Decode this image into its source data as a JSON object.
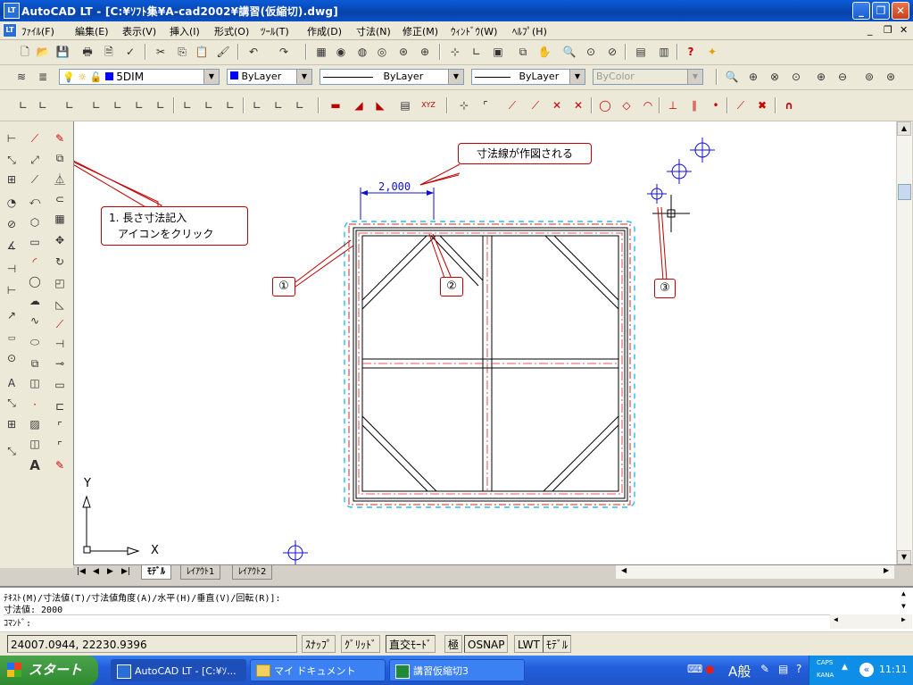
{
  "window": {
    "title": "AutoCAD LT - [C:¥ｿﾌﾄ集¥A-cad2002¥講習(仮縮切).dwg]",
    "app_icon": "LT",
    "controls": [
      "minimize",
      "restore",
      "close"
    ]
  },
  "menubar": {
    "items": [
      "ﾌｧｲﾙ(F)",
      "編集(E)",
      "表示(V)",
      "挿入(I)",
      "形式(O)",
      "ﾂｰﾙ(T)",
      "作成(D)",
      "寸法(N)",
      "修正(M)",
      "ｳｨﾝﾄﾞｳ(W)",
      "ﾍﾙﾌﾟ(H)"
    ]
  },
  "properties_toolbar": {
    "layer_value": "5DIM",
    "color_value": "ByLayer",
    "linetype_value": "ByLayer",
    "lineweight_value": "ByLayer",
    "plotstyle_value": "ByColor"
  },
  "drawing": {
    "dimension_text": "2,000",
    "callout_main": "寸法線が作図される",
    "callout_step_line1": "1. 長さ寸法記入",
    "callout_step_line2": "アイコンをクリック",
    "marker_1": "①",
    "marker_2": "②",
    "marker_3": "③",
    "ucs_x": "X",
    "ucs_y": "Y"
  },
  "tabs": [
    "ﾓﾃﾞﾙ",
    "ﾚｲｱｳﾄ1",
    "ﾚｲｱｳﾄ2"
  ],
  "command": {
    "line1": "ﾃｷｽﾄ(M)/寸法値(T)/寸法値角度(A)/水平(H)/垂直(V)/回転(R)]:",
    "line2": "寸法値: 2000",
    "prompt": "ｺﾏﾝﾄﾞ:"
  },
  "status": {
    "coords": "24007.0944, 22230.9396",
    "toggles": [
      "ｽﾅｯﾌﾟ",
      "ｸﾞﾘｯﾄﾞ",
      "直交ﾓｰﾄﾞ",
      "極",
      "OSNAP",
      "LWT",
      "ﾓﾃﾞﾙ"
    ]
  },
  "taskbar": {
    "start_label": "スタート",
    "tasks": [
      "AutoCAD LT - [C:¥ｿ...",
      "マイ ドキュメント",
      "講習仮縮切3"
    ],
    "tray_caps": "CAPS",
    "tray_kana": "KANA",
    "tray_ime": "A般",
    "clock": "11:11"
  }
}
